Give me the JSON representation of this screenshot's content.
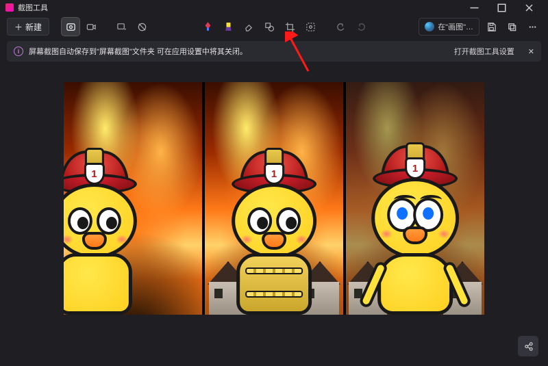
{
  "titlebar": {
    "title": "截图工具"
  },
  "toolbar": {
    "new_label": "新建",
    "paint_label": "在\"画图\"…"
  },
  "notice": {
    "message": "屏幕截图自动保存到\"屏幕截图\"文件夹    可在应用设置中将其关闭。",
    "link_label": "打开截图工具设置"
  },
  "helmet_badge": "1"
}
